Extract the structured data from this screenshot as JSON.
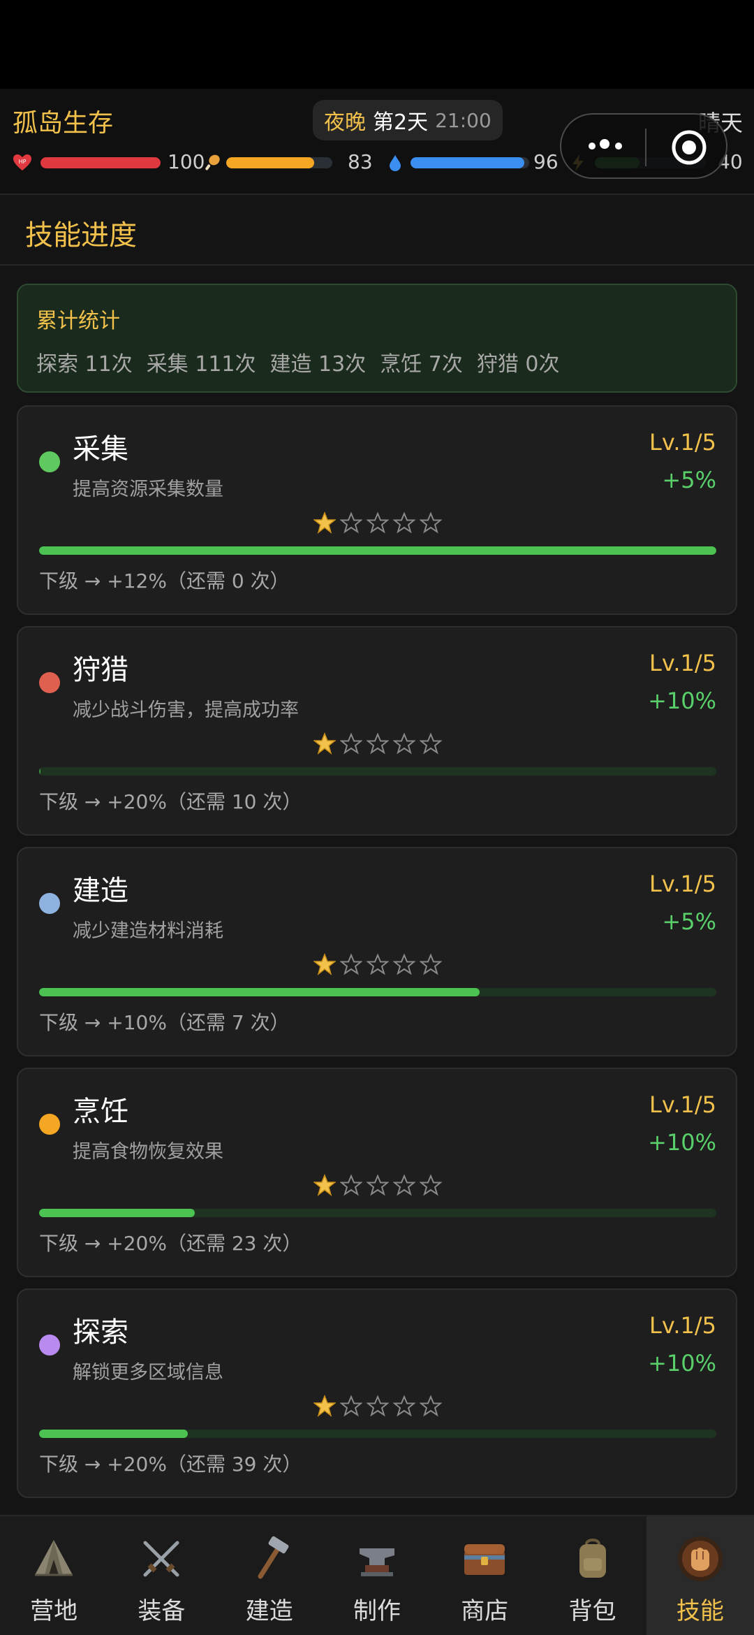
{
  "header": {
    "app_title": "孤岛生存",
    "time_phase": "夜晚",
    "day": "第2天",
    "clock": "21:00",
    "weather": "晴天",
    "stats": [
      {
        "name": "hp",
        "icon": "heart-hp-icon",
        "value": "100",
        "fraction": 1.0,
        "color": "#e0393f"
      },
      {
        "name": "hunger",
        "icon": "drumstick-icon",
        "value": "83",
        "fraction": 0.83,
        "color": "#f5a623"
      },
      {
        "name": "thirst",
        "icon": "water-drop-icon",
        "value": "96",
        "fraction": 0.96,
        "color": "#3b8ff0"
      },
      {
        "name": "energy",
        "icon": "lightning-icon",
        "value": "40",
        "fraction": 0.4,
        "color": "#3c9b44"
      }
    ]
  },
  "section": {
    "title": "技能进度"
  },
  "summary": {
    "title": "累计统计",
    "items": [
      "探索 11次",
      "采集 111次",
      "建造 13次",
      "烹饪 7次",
      "狩猎 0次"
    ]
  },
  "skills": [
    {
      "name": "采集",
      "desc": "提高资源采集数量",
      "level": "Lv.1/5",
      "bonus": "+5%",
      "stars": 1,
      "progress": 1.0,
      "next": "下级 → +12%（还需 0 次）",
      "color": "#5fc95f"
    },
    {
      "name": "狩猎",
      "desc": "减少战斗伤害，提高成功率",
      "level": "Lv.1/5",
      "bonus": "+10%",
      "stars": 1,
      "progress": 0.0,
      "next": "下级 → +20%（还需 10 次）",
      "color": "#e0604f"
    },
    {
      "name": "建造",
      "desc": "减少建造材料消耗",
      "level": "Lv.1/5",
      "bonus": "+5%",
      "stars": 1,
      "progress": 0.65,
      "next": "下级 → +10%（还需 7 次）",
      "color": "#8fb3e0"
    },
    {
      "name": "烹饪",
      "desc": "提高食物恢复效果",
      "level": "Lv.1/5",
      "bonus": "+10%",
      "stars": 1,
      "progress": 0.23,
      "next": "下级 → +20%（还需 23 次）",
      "color": "#f5a623"
    },
    {
      "name": "探索",
      "desc": "解锁更多区域信息",
      "level": "Lv.1/5",
      "bonus": "+10%",
      "stars": 1,
      "progress": 0.22,
      "next": "下级 → +20%（还需 39 次）",
      "color": "#b98af0"
    }
  ],
  "nav": [
    {
      "label": "营地",
      "icon": "tent-icon",
      "active": false
    },
    {
      "label": "装备",
      "icon": "crossed-swords-icon",
      "active": false
    },
    {
      "label": "建造",
      "icon": "hammer-icon",
      "active": false
    },
    {
      "label": "制作",
      "icon": "anvil-icon",
      "active": false
    },
    {
      "label": "商店",
      "icon": "chest-icon",
      "active": false
    },
    {
      "label": "背包",
      "icon": "backpack-icon",
      "active": false
    },
    {
      "label": "技能",
      "icon": "fist-icon",
      "active": true
    }
  ]
}
